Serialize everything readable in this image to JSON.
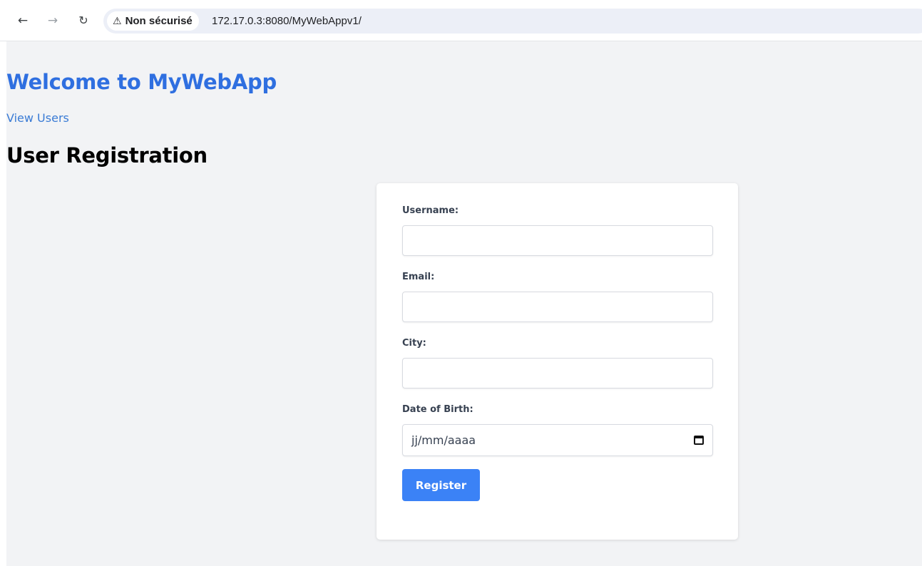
{
  "browser": {
    "security_label": "Non sécurisé",
    "url": "172.17.0.3:8080/MyWebAppv1/",
    "icons": {
      "back": "arrow-left",
      "forward": "arrow-right",
      "reload": "reload",
      "security": "warning-triangle"
    }
  },
  "page": {
    "heading": "Welcome to MyWebApp",
    "view_users_link": "View Users",
    "section_title": "User Registration",
    "accent_color": "#2f6fe0"
  },
  "form": {
    "username_label": "Username:",
    "username_value": "",
    "email_label": "Email:",
    "email_value": "",
    "city_label": "City:",
    "city_value": "",
    "dob_label": "Date of Birth:",
    "dob_placeholder": "jj/mm/aaaa",
    "submit_label": "Register",
    "button_color": "#3b82f6"
  }
}
